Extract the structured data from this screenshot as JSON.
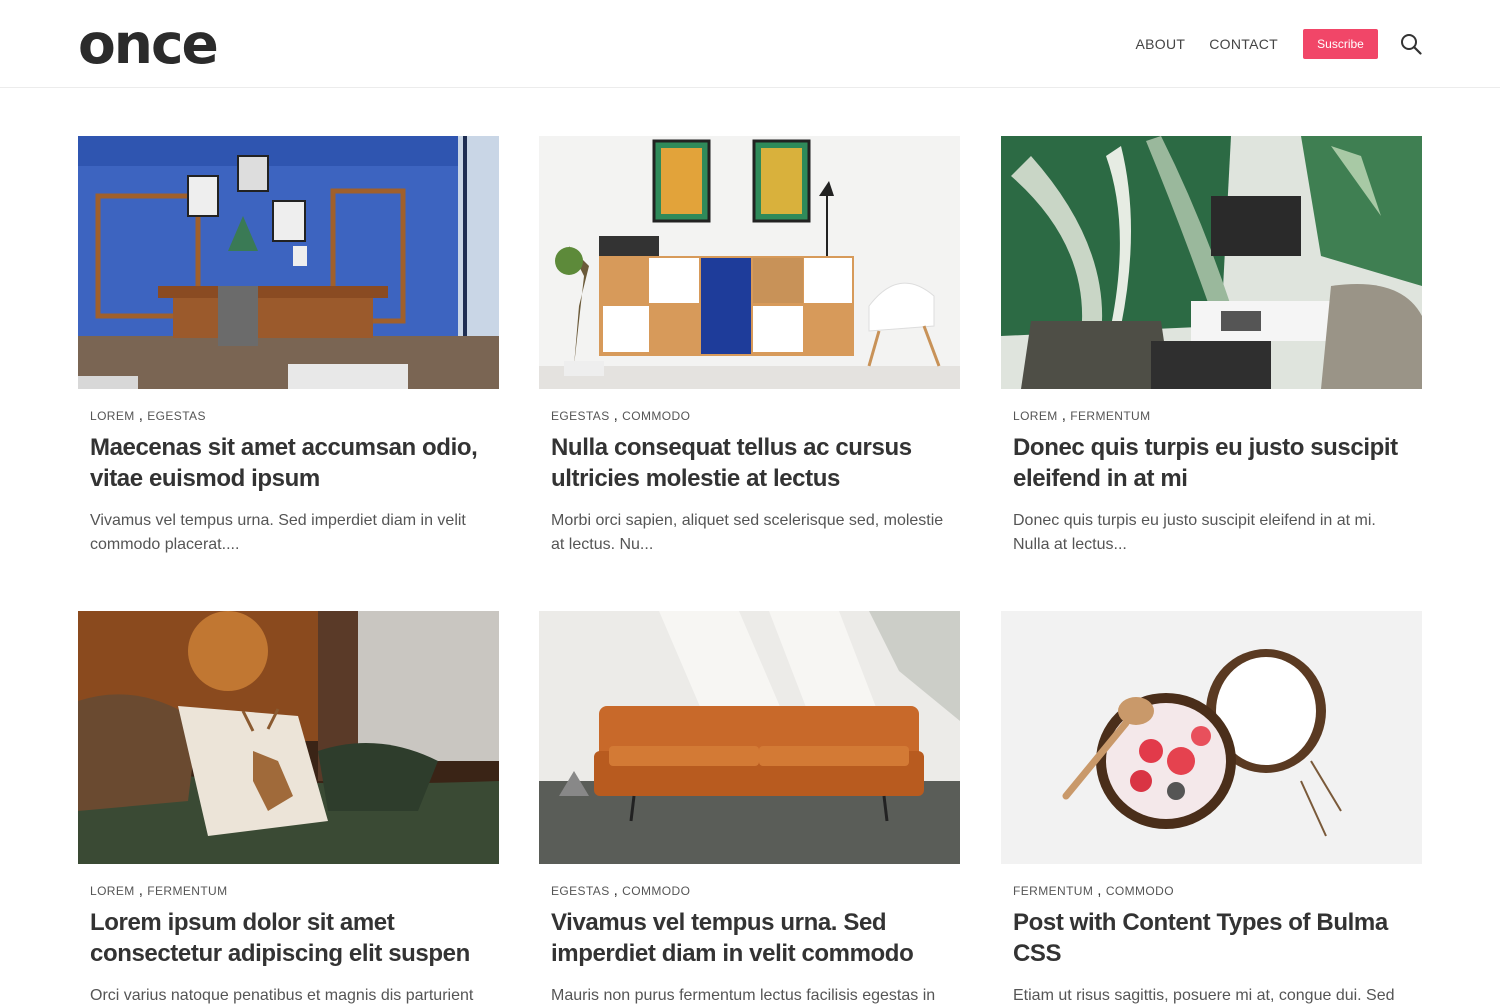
{
  "header": {
    "logo": "once",
    "nav": {
      "about": "ABOUT",
      "contact": "CONTACT",
      "subscribe": "Suscribe"
    },
    "accent_color": "#f14668"
  },
  "posts": [
    {
      "tags": [
        "LOREM",
        "EGESTAS"
      ],
      "title": "Maecenas sit amet accumsan odio, vitae euismod ipsum",
      "excerpt": "Vivamus vel tempus urna. Sed imperdiet diam in velit commodo placerat....",
      "image": "blue-office-room"
    },
    {
      "tags": [
        "EGESTAS",
        "COMMODO"
      ],
      "title": "Nulla consequat tellus ac cursus ultricies molestie at lectus",
      "excerpt": "Morbi orci sapien, aliquet sed scelerisque sed, molestie at lectus. Nu...",
      "image": "sideboard-with-paintings"
    },
    {
      "tags": [
        "LOREM",
        "FERMENTUM"
      ],
      "title": "Donec quis turpis eu justo suscipit eleifend in at mi",
      "excerpt": "Donec quis turpis eu justo suscipit eleifend in at mi. Nulla at lectus...",
      "image": "tropical-living-room"
    },
    {
      "tags": [
        "LOREM",
        "FERMENTUM"
      ],
      "title": "Lorem ipsum dolor sit amet consectetur adipiscing elit suspen",
      "excerpt": "Orci varius natoque penatibus et magnis dis parturient",
      "image": "deer-pillow-bed"
    },
    {
      "tags": [
        "EGESTAS",
        "COMMODO"
      ],
      "title": "Vivamus vel tempus urna. Sed imperdiet diam in velit commodo",
      "excerpt": "Mauris non purus fermentum lectus facilisis egestas in",
      "image": "orange-leather-sofa"
    },
    {
      "tags": [
        "FERMENTUM",
        "COMMODO"
      ],
      "title": "Post with Content Types of Bulma CSS",
      "excerpt": "Etiam ut risus sagittis, posuere mi at, congue dui. Sed",
      "image": "coconut-bowl"
    }
  ]
}
